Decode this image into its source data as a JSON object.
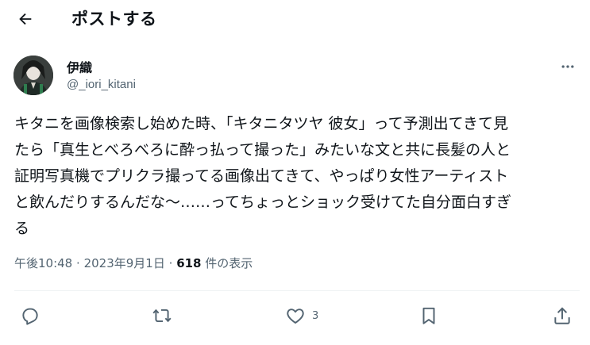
{
  "header": {
    "title": "ポストする",
    "back_icon": "arrow-left-icon"
  },
  "author": {
    "display_name": "伊織",
    "username": "@_iori_kitani",
    "avatar_icon": "avatar-image"
  },
  "more_icon": "more-horizontal-icon",
  "tweet": {
    "text": "キタニを画像検索し始めた時、「キタニタツヤ 彼女」って予測出てきて見\nたら「真生とべろべろに酔っ払って撮った」みたいな文と共に長髪の人と\n証明写真機でプリクラ撮ってる画像出てきて、やっぱり女性アーティスト\nと飲んだりするんだな〜……ってちょっとショック受けてた自分面白すぎ\nる"
  },
  "meta": {
    "time": "午後10:48",
    "separator": "·",
    "date": "2023年9月1日",
    "views_count": "618",
    "views_label": "件の表示"
  },
  "actions": {
    "reply_icon": "reply-icon",
    "repost_icon": "repost-icon",
    "like_icon": "heart-icon",
    "like_count": "3",
    "bookmark_icon": "bookmark-icon",
    "share_icon": "share-icon"
  },
  "colors": {
    "text": "#0f1419",
    "secondary": "#536471",
    "divider": "#eff3f4",
    "background": "#ffffff"
  }
}
